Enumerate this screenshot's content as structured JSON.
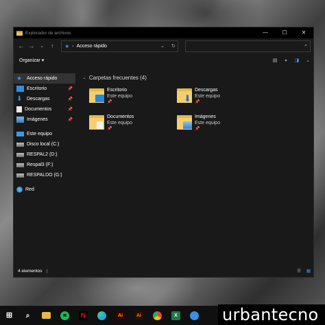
{
  "window": {
    "title": "Explorador de archivos",
    "controls": {
      "minimize": "—",
      "maximize": "☐",
      "close": "✕"
    }
  },
  "nav": {
    "back": "←",
    "forward": "→",
    "recent": "⌄",
    "up": "↑",
    "address_separator": "›",
    "address": "Acceso rápido",
    "address_dropdown": "⌄",
    "refresh": "↻",
    "search_placeholder": "",
    "search_icon": "⌕"
  },
  "toolbar": {
    "organize_label": "Organizar",
    "organize_arrow": "▾"
  },
  "sidebar": {
    "quick_access": "Acceso rápido",
    "items": [
      {
        "label": "Escritorio",
        "pinned": true,
        "icon": "desktop-icon",
        "color": "#2f8fe0"
      },
      {
        "label": "Descargas",
        "pinned": true,
        "icon": "download-icon",
        "color": "#2f8fe0"
      },
      {
        "label": "Documentos",
        "pinned": true,
        "icon": "document-icon",
        "color": "#e8e8e8"
      },
      {
        "label": "Imágenes",
        "pinned": true,
        "icon": "pictures-icon",
        "color": "#7fb5e6"
      }
    ],
    "this_pc": "Este equipo",
    "drives": [
      {
        "label": "Disco local (C:)"
      },
      {
        "label": "RESPAL2 (D:)"
      },
      {
        "label": "Respal3 (F:)"
      },
      {
        "label": "RESPALDO (G:)"
      }
    ],
    "network": "Red"
  },
  "main": {
    "group_title": "Carpetas frecuentes (4)",
    "group_chevron": "⌄",
    "folders": [
      {
        "name": "Escritorio",
        "location": "Este equipo",
        "badge_color": "#1f8ae0"
      },
      {
        "name": "Descargas",
        "location": "Este equipo",
        "badge_color": "#1f6fd0"
      },
      {
        "name": "Documentos",
        "location": "Este equipo",
        "badge_color": "#f0f0f0"
      },
      {
        "name": "Imágenes",
        "location": "Este equipo",
        "badge_color": "#5a9ad8"
      }
    ],
    "pin_glyph": "📌"
  },
  "statusbar": {
    "items_count": "4 elementos",
    "separator": "|"
  },
  "taskbar": {
    "apps": [
      {
        "name": "windows-icon",
        "color": "#ffffff"
      },
      {
        "name": "search-icon",
        "color": "#ffffff"
      },
      {
        "name": "file-explorer-icon",
        "color": "#e8b84a"
      },
      {
        "name": "spotify-icon",
        "color": "#1db954"
      },
      {
        "name": "netflix-icon",
        "color": "#e50914"
      },
      {
        "name": "edge-icon",
        "color": "#2f9ee0"
      },
      {
        "name": "illustrator-icon",
        "color": "#ff9a00"
      },
      {
        "name": "illustrator-icon-2",
        "color": "#ff7c00"
      },
      {
        "name": "chrome-icon",
        "color": "#e8453c"
      },
      {
        "name": "excel-icon",
        "color": "#1d7a45"
      },
      {
        "name": "vpn-icon",
        "color": "#3a8ee6"
      }
    ]
  },
  "watermark": "urbantecno"
}
